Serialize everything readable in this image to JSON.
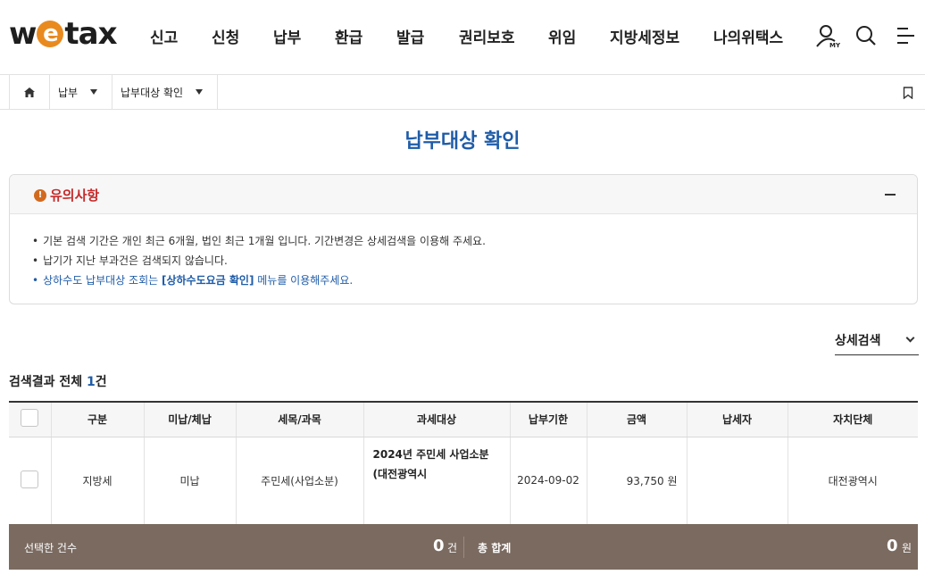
{
  "header": {
    "logo": {
      "pre": "w",
      "mid": "e",
      "post": "tax"
    },
    "menu": [
      "신고",
      "신청",
      "납부",
      "환급",
      "발급",
      "권리보호",
      "위임",
      "지방세정보",
      "나의위택스"
    ],
    "icons": [
      "my-page-icon",
      "search-icon",
      "menu-icon"
    ],
    "my_label": "MY"
  },
  "breadcrumb": {
    "home_icon": "home-icon",
    "level1": "납부",
    "level2": "납부대상 확인",
    "bookmark_icon": "bookmark-icon"
  },
  "page": {
    "title": "납부대상 확인"
  },
  "notice": {
    "title": "유의사항",
    "icon_glyph": "!",
    "items": [
      "기본 검색 기간은 개인 최근 6개월, 법인 최근 1개월 입니다. 기간변경은 상세검색을 이용해 주세요.",
      "납기가 지난 부과건은 검색되지 않습니다."
    ],
    "link_item": {
      "pre": "상하수도 납부대상 조회는 ",
      "bold": "[상하수도요금 확인]",
      "post": " 메뉴를 이용해주세요."
    }
  },
  "detail_search": {
    "label": "상세검색"
  },
  "results": {
    "label": "검색결과 전체 ",
    "count": "1",
    "unit": "건"
  },
  "table": {
    "headers": [
      "구분",
      "미납/체납",
      "세목/과목",
      "과세대상",
      "납부기한",
      "금액",
      "납세자",
      "자치단체"
    ],
    "rows": [
      {
        "type": "지방세",
        "status": "미납",
        "tax_item": "주민세(사업소분)",
        "target": "2024년 주민세 사업소분(대전광역시",
        "due_date": "2024-09-02",
        "amount": "93,750 원",
        "taxpayer": "",
        "region": "대전광역시"
      }
    ]
  },
  "summary": {
    "selected_label": "선택한 건수",
    "selected_value": "0",
    "selected_unit": "건",
    "total_label": "총 합계",
    "total_value": "0",
    "total_unit": "원"
  },
  "colors": {
    "brand_orange": "#e98a1f",
    "title_blue": "#1f5ca8",
    "notice_red": "#c62b2b",
    "summary_bg": "#7a6a60"
  }
}
